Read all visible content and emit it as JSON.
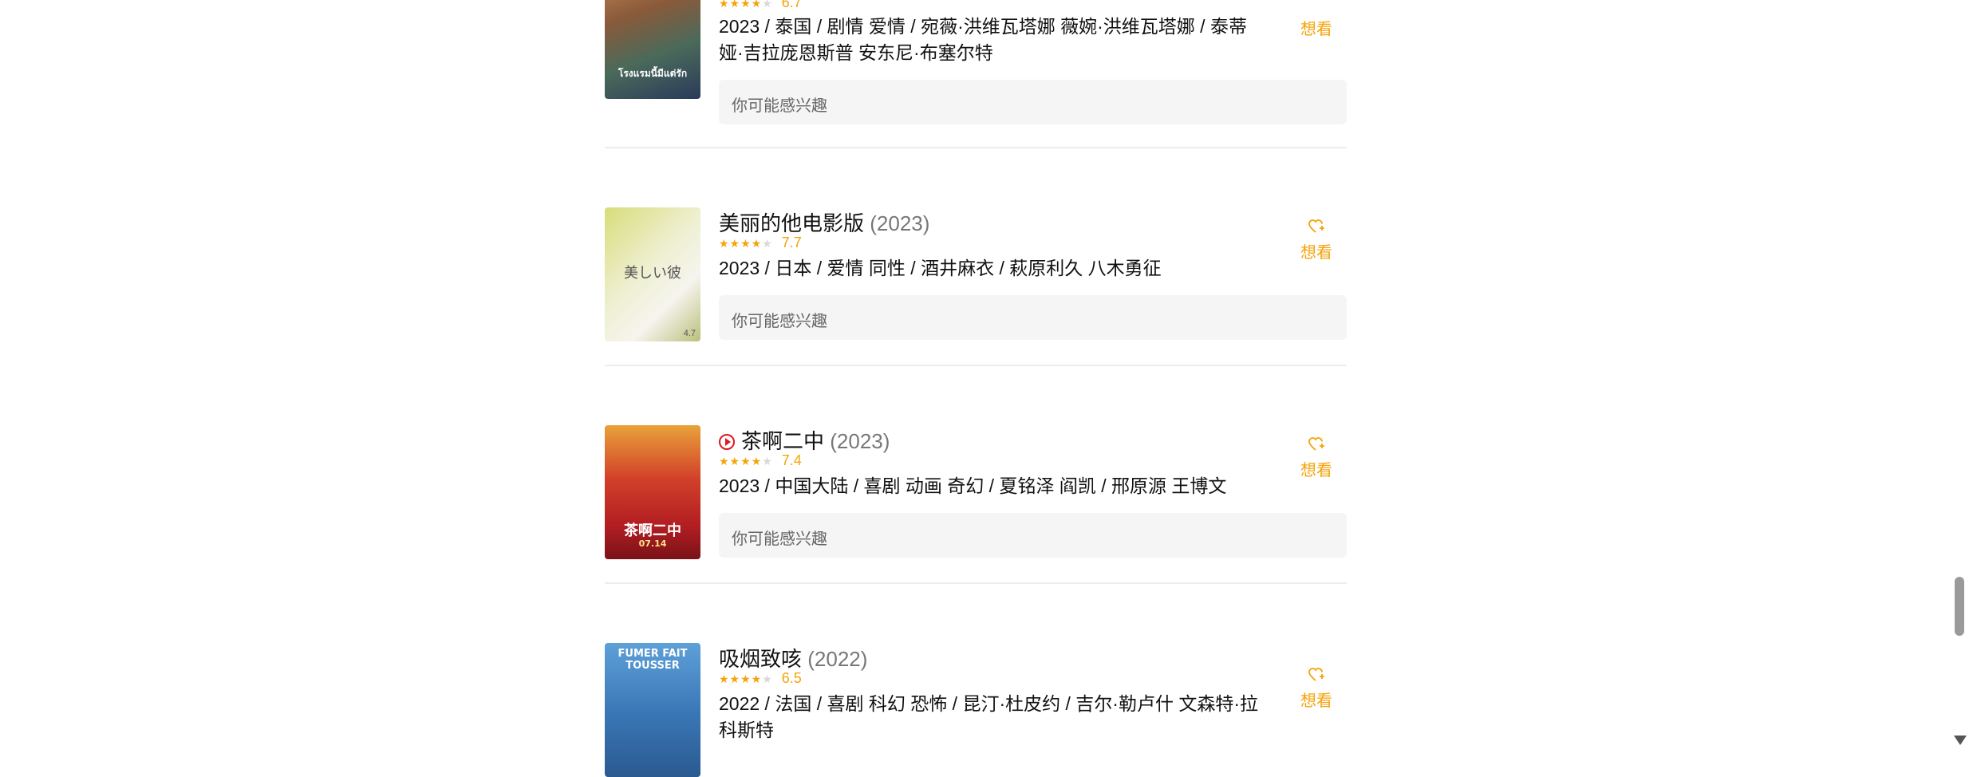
{
  "colors": {
    "accent": "#f5a30a",
    "play": "#e0171f",
    "divider": "#ececec",
    "interest_bg": "#f5f5f5"
  },
  "items": [
    {
      "title": "",
      "year": "",
      "score": "6.7",
      "stars_filled": 3.5,
      "meta": "2023 / 泰国 / 剧情 爱情 / 宛薇·洪维瓦塔娜 薇婉·洪维瓦塔娜 / 泰蒂娅·吉拉庞恩斯普 安东尼·布塞尔特",
      "interest": "你可能感兴趣",
      "want": "想看",
      "poster_text": "โรงแรมนี้มีแต่รัก"
    },
    {
      "title": "美丽的他电影版",
      "year": "(2023)",
      "score": "7.7",
      "stars_filled": 4,
      "meta": "2023 / 日本 / 爱情 同性 / 酒井麻衣 / 萩原利久 八木勇征",
      "interest": "你可能感兴趣",
      "want": "想看",
      "poster_text": "美しい彼",
      "poster_date": "4.7"
    },
    {
      "title": "茶啊二中",
      "year": "(2023)",
      "score": "7.4",
      "stars_filled": 3.5,
      "meta": "2023 / 中国大陆 / 喜剧 动画 奇幻 / 夏铭泽 阎凯 / 邢原源 王博文",
      "interest": "你可能感兴趣",
      "want": "想看",
      "poster_text": "茶啊二中",
      "poster_date": "07.14"
    },
    {
      "title": "吸烟致咳",
      "year": "(2022)",
      "score": "6.5",
      "stars_filled": 3.5,
      "meta": "2022 / 法国 / 喜剧 科幻 恐怖 / 昆汀·杜皮约 / 吉尔·勒卢什 文森特·拉科斯特",
      "want": "想看",
      "poster_text": "FUMER FAIT TOUSSER"
    }
  ]
}
